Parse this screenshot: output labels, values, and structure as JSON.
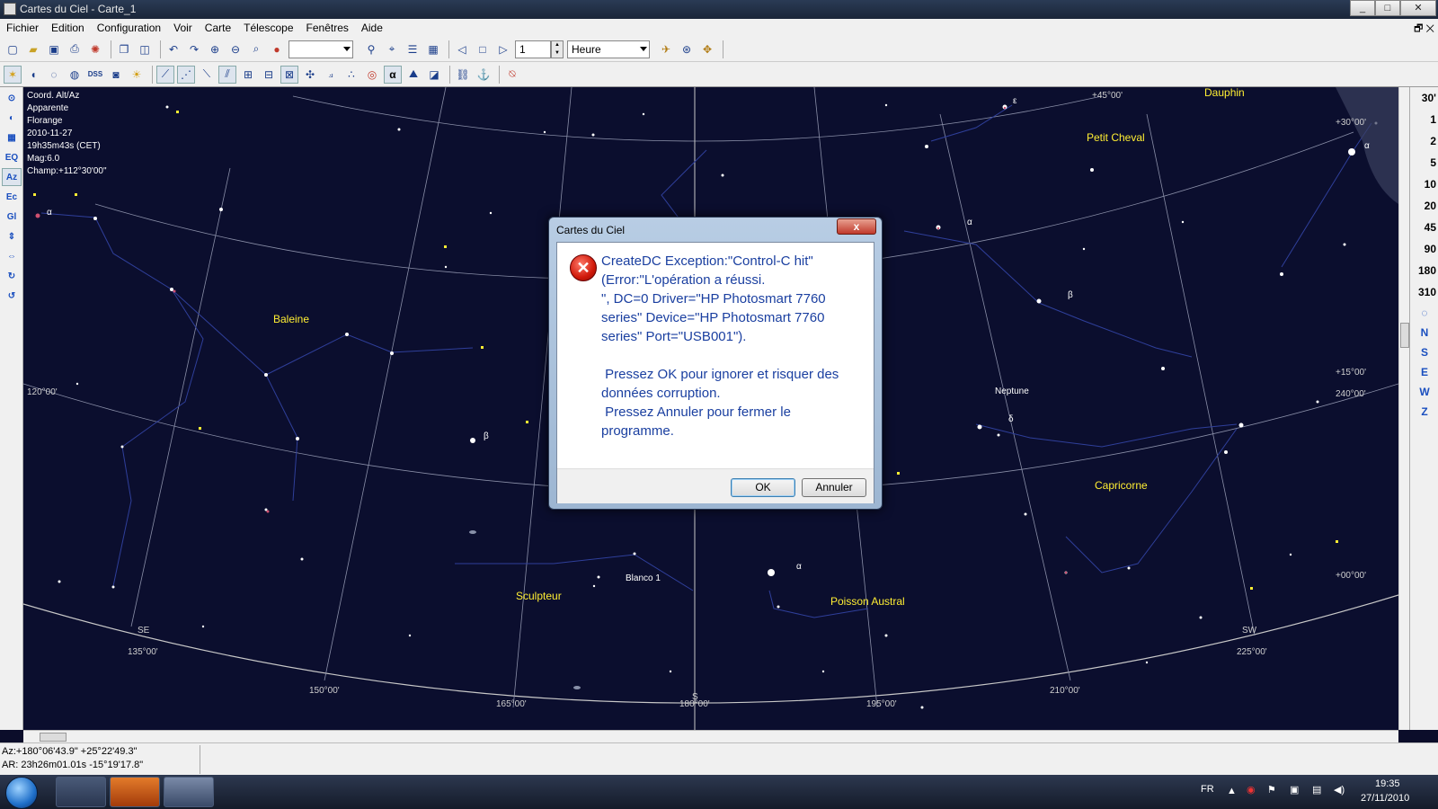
{
  "window": {
    "title": "Cartes du Ciel - Carte_1",
    "controls": [
      "_",
      "□",
      "✕"
    ]
  },
  "menubar": {
    "items": [
      "Fichier",
      "Edition",
      "Configuration",
      "Voir",
      "Carte",
      "Télescope",
      "Fenêtres",
      "Aide"
    ],
    "mdi": "🗗 ✕"
  },
  "toolbar1": {
    "combo_empty": "",
    "spin_value": "1",
    "time_unit": "Heure"
  },
  "toolbar2": {
    "dss_label": "DSS",
    "alpha_label": "α"
  },
  "left_toolbar": [
    "⊙",
    "◐",
    "▦",
    "EQ",
    "Az",
    "Ec",
    "Gl",
    "⇕",
    "⇔",
    "↻",
    "↺"
  ],
  "right_toolbar": {
    "fields": [
      "30'",
      "1",
      "2",
      "5",
      "10",
      "20",
      "45",
      "90",
      "180",
      "310"
    ],
    "directions": [
      "N",
      "S",
      "E",
      "W",
      "Z"
    ]
  },
  "map_info": {
    "lines": [
      "Coord. Alt/Az",
      "Apparente",
      "Florange",
      "2010-11-27",
      "19h35m43s (CET)",
      "Mag:6.0",
      "Champ:+112°30'00\""
    ]
  },
  "constellations": {
    "dauphin": "Dauphin",
    "petit_cheval": "Petit Cheval",
    "baleine": "Baleine",
    "capricorne": "Capricorne",
    "sculpteur": "Sculpteur",
    "poisson_austral": "Poisson Austral"
  },
  "objects": {
    "neptune": "Neptune",
    "blanco": "Blanco 1"
  },
  "greek": {
    "alpha": "α",
    "beta": "β",
    "delta": "δ",
    "epsilon": "ε"
  },
  "grid_labels": {
    "alt45": "+45°00'",
    "alt30": "+30°00'",
    "alt15": "+15°00'",
    "alt0": "+00°00'",
    "az120": "120°00'",
    "az240": "240°00'",
    "az135": "135°00'",
    "az150": "150°00'",
    "az165": "165°00'",
    "az180": "180°00'",
    "az195": "195°00'",
    "az210": "210°00'",
    "az225": "225°00'",
    "se": "SE",
    "sw": "SW",
    "s": "S"
  },
  "status": {
    "line1": "Az:+180°06'43.9\" +25°22'49.3\"",
    "line2": "AR: 23h26m01.01s -15°19'17.8\""
  },
  "dialog": {
    "title": "Cartes du Ciel",
    "close": "x",
    "message": "CreateDC Exception:\"Control-C hit\"\n(Error:\"L'opération a réussi.\n\", DC=0 Driver=\"HP Photosmart 7760\nseries\" Device=\"HP Photosmart 7760\nseries\" Port=\"USB001\").\n\n Pressez OK pour ignorer et risquer des\ndonnées corruption.\n Pressez Annuler pour fermer le\nprogramme.",
    "ok": "OK",
    "cancel": "Annuler"
  },
  "taskbar": {
    "lang": "FR",
    "time": "19:35",
    "date": "27/11/2010"
  },
  "colors": {
    "sky": "#0b0e2e",
    "constellation_label": "#ffee33",
    "grid": "#8a8fa8",
    "lines": "#2f3f9a"
  }
}
